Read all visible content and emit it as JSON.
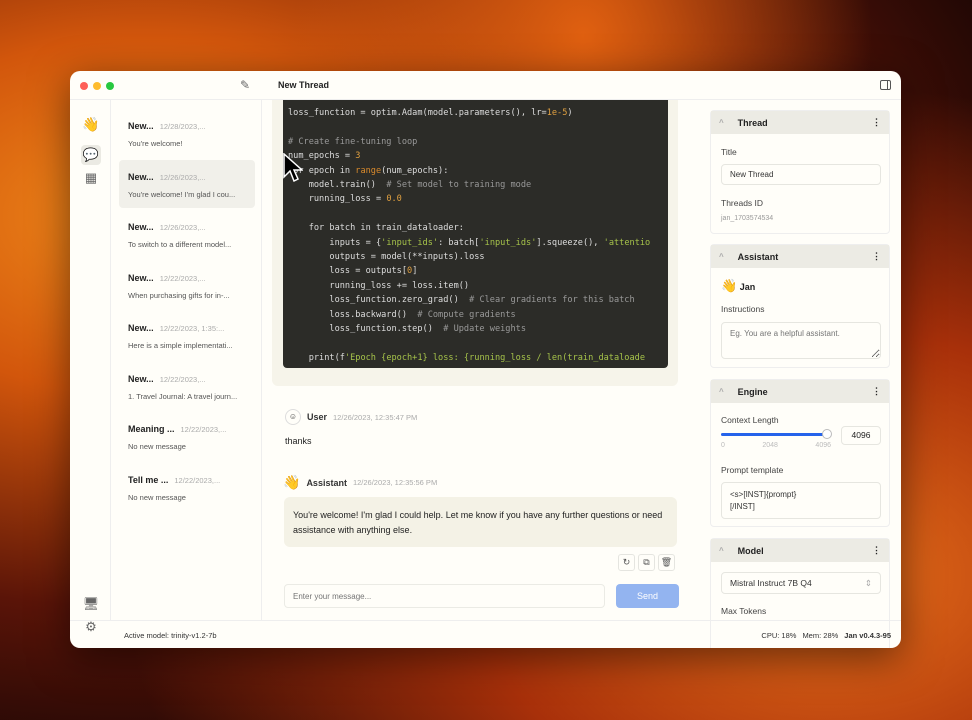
{
  "window": {
    "title": "New Thread"
  },
  "threads": [
    {
      "title": "New...",
      "date": "12/28/2023,...",
      "preview": "You're welcome!"
    },
    {
      "title": "New...",
      "date": "12/26/2023,...",
      "preview": "You're welcome! I'm glad I cou..."
    },
    {
      "title": "New...",
      "date": "12/26/2023,...",
      "preview": "To switch to a different model..."
    },
    {
      "title": "New...",
      "date": "12/22/2023,...",
      "preview": "When purchasing gifts for in-..."
    },
    {
      "title": "New...",
      "date": "12/22/2023, 1:35:...",
      "preview": "Here is a simple implementati..."
    },
    {
      "title": "New...",
      "date": "12/22/2023,...",
      "preview": "1. Travel Journal: A travel journ..."
    },
    {
      "title": "Meaning ...",
      "date": "12/22/2023,...",
      "preview": "No new message"
    },
    {
      "title": "Tell me ...",
      "date": "12/22/2023,...",
      "preview": "No new message"
    }
  ],
  "code_lines": [
    "loss_function = optim.Adam(model.parameters(), lr=1e-5)",
    "",
    "# Create fine-tuning loop",
    "num_epochs = 3",
    "for epoch in range(num_epochs):",
    "    model.train()  # Set model to training mode",
    "    running_loss = 0.0",
    "",
    "    for batch in train_dataloader:",
    "        inputs = {'input_ids': batch['input_ids'].squeeze(), 'attentio",
    "        outputs = model(**inputs).loss",
    "        loss = outputs[0]",
    "        running_loss += loss.item()",
    "        loss_function.zero_grad()  # Clear gradients for this batch",
    "        loss.backward()  # Compute gradients",
    "        loss_function.step()  # Update weights",
    "",
    "    print(f'Epoch {epoch+1} loss: {running_loss / len(train_dataloade"
  ],
  "messages": [
    {
      "role": "User",
      "time": "12/26/2023, 12:35:47 PM",
      "text": "thanks"
    },
    {
      "role": "Assistant",
      "time": "12/26/2023, 12:35:56 PM",
      "text": "You're welcome! I'm glad I could help. Let me know if you have any further questions or need assistance with anything else."
    }
  ],
  "composer": {
    "placeholder": "Enter your message...",
    "send": "Send"
  },
  "panel": {
    "thread": {
      "header": "Thread",
      "title_label": "Title",
      "title_value": "New Thread",
      "id_label": "Threads ID",
      "id_value": "jan_1703574534"
    },
    "assistant": {
      "header": "Assistant",
      "name": "Jan",
      "instructions_label": "Instructions",
      "instructions_placeholder": "Eg. You are a helpful assistant."
    },
    "engine": {
      "header": "Engine",
      "context_label": "Context Length",
      "context_value": "4096",
      "context_fraction": 1.0,
      "ticks": [
        "0",
        "2048",
        "4096"
      ],
      "prompt_label": "Prompt template",
      "prompt_value": "<s>[INST]{prompt}\n[/INST]"
    },
    "model": {
      "header": "Model",
      "selected": "Mistral Instruct 7B Q4",
      "max_tokens_label": "Max Tokens"
    }
  },
  "status": {
    "active_model": "Active model: trinity-v1.2-7b",
    "cpu": "CPU: 18%",
    "mem": "Mem: 28%",
    "version": "Jan v0.4.3-95"
  },
  "colors": {
    "accent": "#2563eb",
    "send_disabled": "#93b4f0"
  }
}
